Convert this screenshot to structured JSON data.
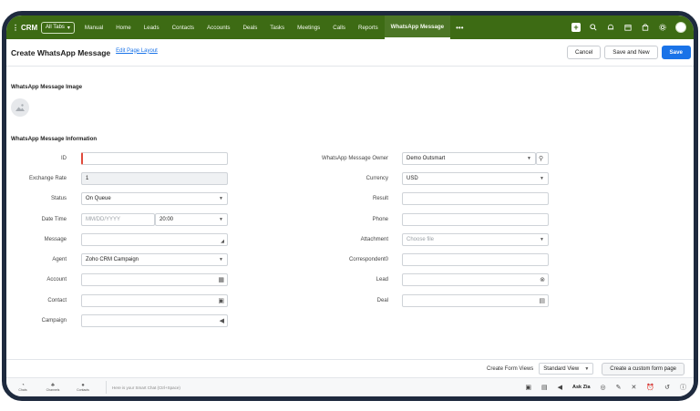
{
  "topbar": {
    "brand": "CRM",
    "all_tabs": "All Tabs",
    "tabs": [
      "Manual",
      "Home",
      "Leads",
      "Contacts",
      "Accounts",
      "Deals",
      "Tasks",
      "Meetings",
      "Calls",
      "Reports",
      "WhatsApp Message"
    ],
    "active_tab": "WhatsApp Message",
    "more": "•••"
  },
  "header": {
    "title": "Create WhatsApp Message",
    "edit_layout": "Edit Page Layout",
    "cancel": "Cancel",
    "save_and_new": "Save and New",
    "save": "Save"
  },
  "sections": {
    "image": "WhatsApp Message Image",
    "info": "WhatsApp Message Information"
  },
  "left_fields": [
    {
      "label": "ID",
      "value": "",
      "placeholder": ""
    },
    {
      "label": "Exchange Rate",
      "value": "1"
    },
    {
      "label": "Status",
      "value": "On Queue"
    },
    {
      "label": "Date Time",
      "date_placeholder": "MM/DD/YYYY",
      "time": "20:00"
    },
    {
      "label": "Message",
      "value": ""
    },
    {
      "label": "Agent",
      "value": "Zoho CRM Campaign"
    },
    {
      "label": "Account",
      "value": ""
    },
    {
      "label": "Contact",
      "value": ""
    },
    {
      "label": "Campaign",
      "value": ""
    }
  ],
  "right_fields": [
    {
      "label": "WhatsApp Message Owner",
      "value": "Demo Outsmart"
    },
    {
      "label": "Currency",
      "value": "USD"
    },
    {
      "label": "Result",
      "value": ""
    },
    {
      "label": "Phone",
      "value": ""
    },
    {
      "label": "Attachment",
      "placeholder": "Choose file"
    },
    {
      "label": "Correspondent0",
      "value": ""
    },
    {
      "label": "Lead",
      "value": ""
    },
    {
      "label": "Deal",
      "value": ""
    }
  ],
  "footer": {
    "create_form_views": "Create Form Views",
    "view_selected": "Standard View",
    "custom_button": "Create a custom form page"
  },
  "bottom_bar": {
    "items": [
      "Chats",
      "Channels",
      "Contacts"
    ],
    "smart_chat": "Here is your Smart Chat (Ctrl+Space)",
    "ask_zia": "Ask Zia"
  }
}
